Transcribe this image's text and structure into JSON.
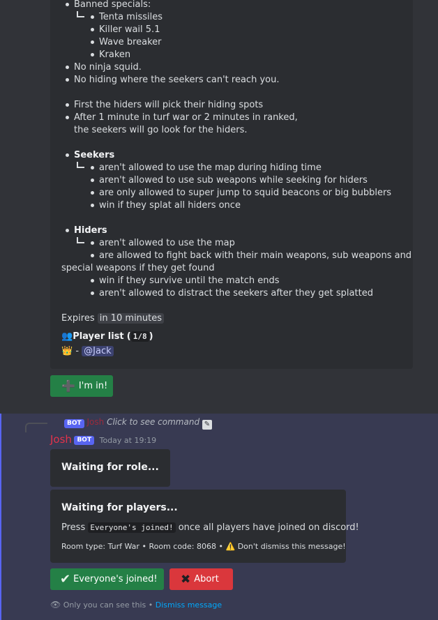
{
  "embed": {
    "banned_specials": "Banned specials:",
    "specials": [
      "Tenta missiles",
      "Killer wail 5.1",
      "Wave breaker",
      "Kraken"
    ],
    "rule_no_ninja": "No ninja squid.",
    "rule_no_hiding": "No hiding where the seekers can't reach you.",
    "flow_1": "First the hiders will pick their hiding spots",
    "flow_2a": "After 1 minute in turf war or 2 minutes in ranked,",
    "flow_2b": "the seekers will go look for the hiders.",
    "seekers_title": "Seekers",
    "seekers_rules": [
      "aren't allowed to use the map during hiding time",
      "aren't allowed to use sub weapons while seeking for hiders",
      "are only allowed to super jump to squid beacons or big bubblers",
      "win if they splat all hiders once"
    ],
    "hiders_title": "Hiders",
    "hiders_rule_1": "aren't allowed to use the map",
    "hiders_rule_2a": "are allowed to fight back with their main weapons, sub weapons and",
    "hiders_rule_2b": "special weapons if they get found",
    "hiders_rule_3": "win if they survive until the match ends",
    "hiders_rule_4": "aren't allowed to distract the seekers after they get splatted",
    "expires_label": "Expires",
    "expires_time": "in 10 minutes",
    "player_list_icon": "👥",
    "player_list_label": "Player list",
    "player_count": "1/8",
    "crown_icon": "👑",
    "dash": "-",
    "player_mention": "@Jack"
  },
  "im_in_button": {
    "icon": "➕",
    "label": "I'm in!"
  },
  "reply": {
    "bot_tag": "BOT",
    "name": "Josh",
    "command_hint": "Click to see command"
  },
  "message": {
    "author": "Josh",
    "bot_tag": "BOT",
    "timestamp": "Today at 19:19",
    "waiting_role": "Waiting for role...",
    "waiting_players": "Waiting for players...",
    "press": "Press",
    "everyone_code": "Everyone's joined!",
    "once_text": "once all players have joined on discord!",
    "room_type": "Room type: Turf War",
    "sep": "•",
    "room_code": "Room code: 8068",
    "warning_icon": "⚠️",
    "dont_dismiss": "Don't dismiss this message!"
  },
  "buttons": {
    "everyone_icon": "✔",
    "everyone_label": "Everyone's joined!",
    "abort_icon": "✖",
    "abort_label": "Abort"
  },
  "footer": {
    "eye_icon": "👁",
    "only_you": "Only you can see this",
    "sep": "•",
    "dismiss": "Dismiss message"
  },
  "colors": {
    "accent": "#5865f2",
    "author": "#e3324b",
    "green": "#248046",
    "red": "#da373c",
    "link": "#00a8fc"
  }
}
